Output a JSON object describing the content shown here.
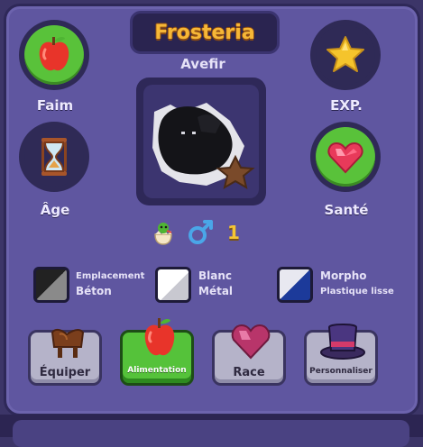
{
  "header": {
    "title": "Frosteria",
    "pet_name": "Avefir"
  },
  "stats": {
    "hunger": {
      "label": "Faim",
      "icon": "apple-icon"
    },
    "age": {
      "label": "Âge",
      "icon": "hourglass-icon"
    },
    "exp": {
      "label": "EXP.",
      "icon": "star-icon"
    },
    "health": {
      "label": "Santé",
      "icon": "heart-gem-icon"
    }
  },
  "pet_info": {
    "species_icon": "hatchling-icon",
    "gender_icon": "male-icon",
    "count": "1"
  },
  "traits": {
    "placement": {
      "label": "Emplacement",
      "value": "Béton"
    },
    "color": {
      "label": "Blanc",
      "value": "Métal"
    },
    "morph": {
      "label": "Morpho",
      "value": "Plastique lisse"
    }
  },
  "actions": {
    "equip": "Équiper",
    "food": "Alimentation",
    "race": "Race",
    "customize": "Personnaliser"
  },
  "colors": {
    "accent_title": "#f6b737",
    "active_button": "#55c23a",
    "panel": "#5f56a0"
  }
}
